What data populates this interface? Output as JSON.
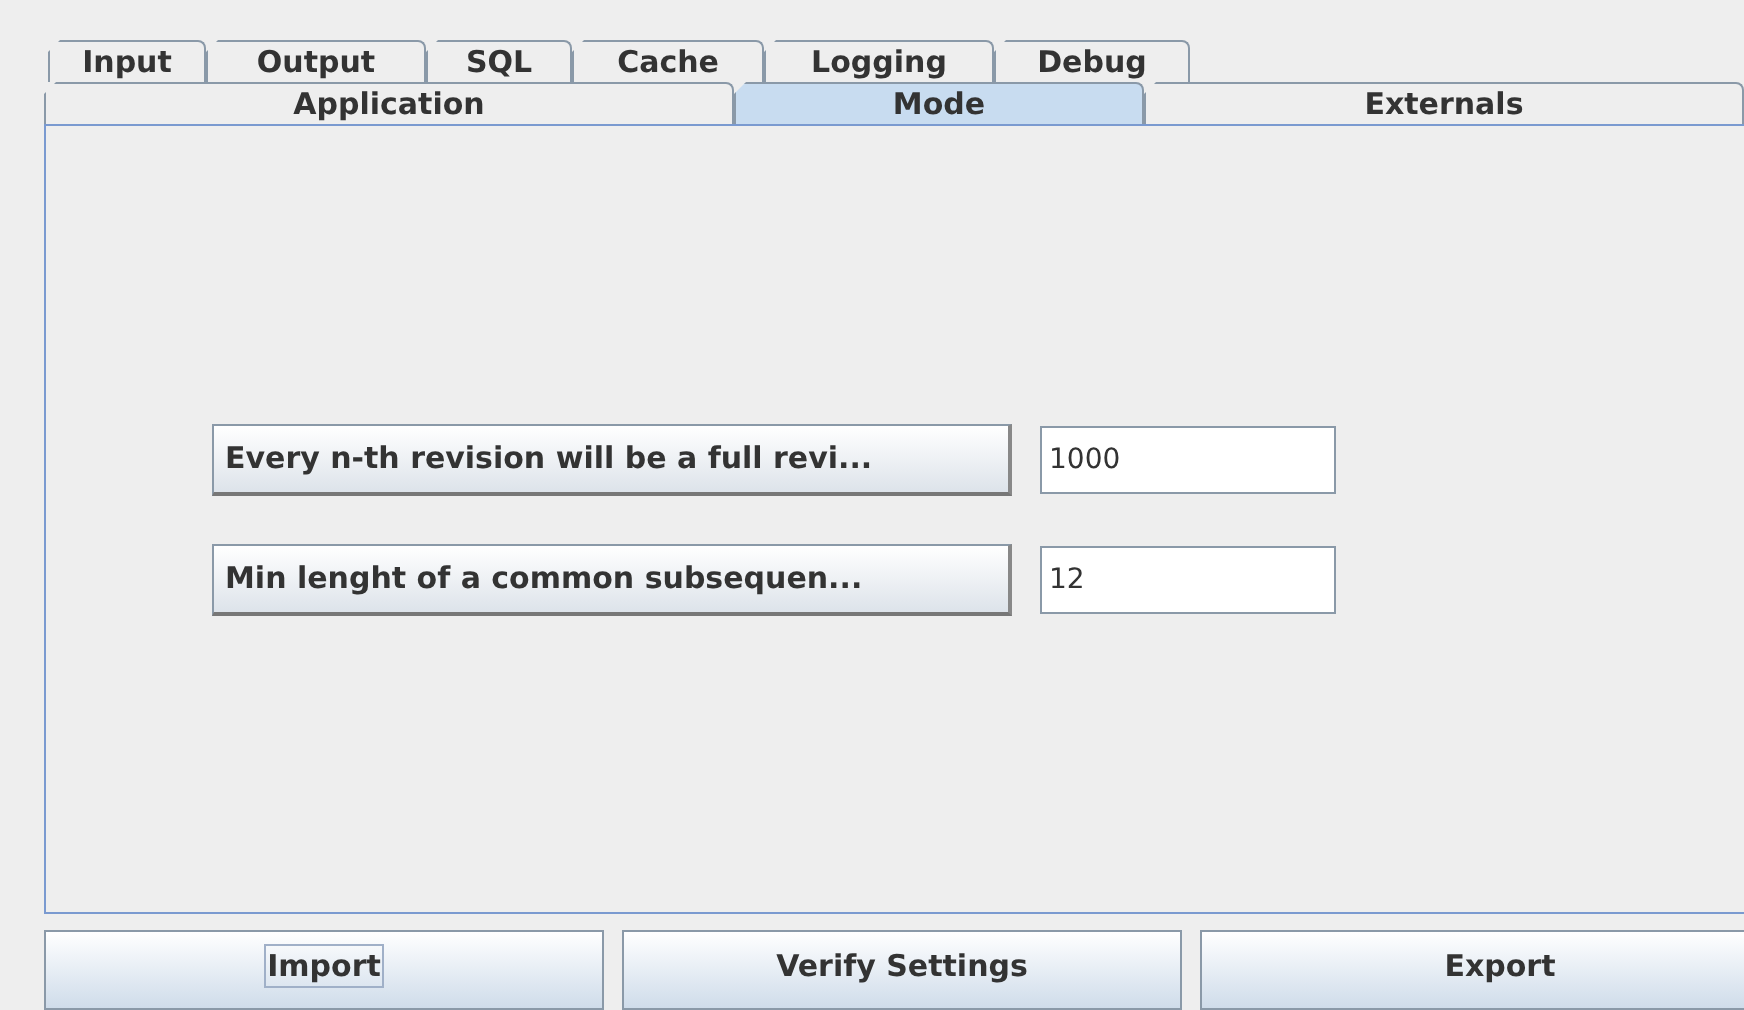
{
  "tab_rows": [
    {
      "tabs": [
        {
          "label": "Input",
          "selected": false
        },
        {
          "label": "Output",
          "selected": false
        },
        {
          "label": "SQL",
          "selected": false
        },
        {
          "label": "Cache",
          "selected": false
        },
        {
          "label": "Logging",
          "selected": false
        },
        {
          "label": "Debug",
          "selected": false
        }
      ]
    },
    {
      "tabs": [
        {
          "label": "Application",
          "selected": false
        },
        {
          "label": "Mode",
          "selected": true
        },
        {
          "label": "Externals",
          "selected": false
        }
      ]
    }
  ],
  "settings": [
    {
      "label": "Every n-th revision will be a full revi...",
      "value": "1000"
    },
    {
      "label": "Min lenght of a common subsequen...",
      "value": "12"
    }
  ],
  "buttons": [
    {
      "label": "Import",
      "focused": true
    },
    {
      "label": "Verify Settings",
      "focused": false
    },
    {
      "label": "Export",
      "focused": false
    }
  ]
}
